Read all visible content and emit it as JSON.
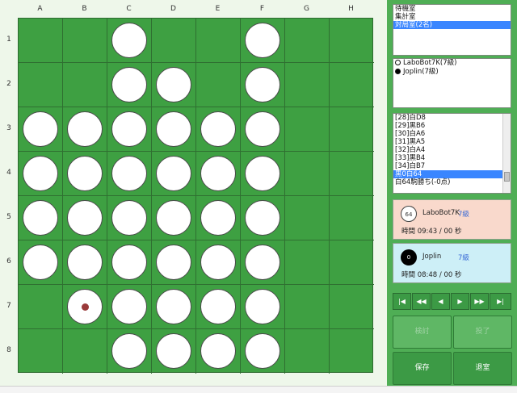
{
  "board": {
    "columns": [
      "A",
      "B",
      "C",
      "D",
      "E",
      "F",
      "G",
      "H"
    ],
    "rows": [
      "1",
      "2",
      "3",
      "4",
      "5",
      "6",
      "7",
      "8"
    ],
    "cells": [
      [
        0,
        0,
        1,
        0,
        0,
        1,
        0,
        0
      ],
      [
        0,
        0,
        1,
        1,
        0,
        1,
        0,
        0
      ],
      [
        1,
        1,
        1,
        1,
        1,
        1,
        0,
        0
      ],
      [
        1,
        1,
        1,
        1,
        1,
        1,
        0,
        0
      ],
      [
        1,
        1,
        1,
        1,
        1,
        1,
        0,
        0
      ],
      [
        1,
        1,
        1,
        1,
        1,
        1,
        0,
        0
      ],
      [
        0,
        1,
        1,
        1,
        1,
        1,
        0,
        0
      ],
      [
        0,
        0,
        1,
        1,
        1,
        1,
        0,
        0
      ]
    ],
    "last_move": {
      "row": 7,
      "col": "B"
    },
    "board_color": "#3ea042",
    "disc_color": "#ffffff"
  },
  "rooms": {
    "items": [
      "待機室",
      "集計室",
      "対局室(2名)"
    ],
    "selected": 2
  },
  "players_list": [
    {
      "color": "white",
      "label": "LaboBot7K(7級)"
    },
    {
      "color": "black",
      "label": "Joplin(7級)"
    }
  ],
  "moves": {
    "items": [
      "[28]白D8",
      "[29]黒B6",
      "[30]白A6",
      "[31]黒A5",
      "[32]白A4",
      "[33]黒B4",
      "[34]白B7",
      "黒0白64",
      "白64駒勝ち(-0点)"
    ],
    "selected": 7
  },
  "player_white": {
    "count": "64",
    "name": "LaboBot7K",
    "rank": "7級",
    "time": "時間 09:43 / 00 秒",
    "bg": "#f9d9cc"
  },
  "player_black": {
    "count": "0",
    "name": "Joplin",
    "rank": "7級",
    "time": "時間 08:48 / 00 秒",
    "bg": "#cdeff7"
  },
  "nav": {
    "first": "|◀",
    "prev_fast": "◀◀",
    "prev": "◀",
    "next": "▶",
    "next_fast": "▶▶",
    "last": "▶|"
  },
  "buttons": {
    "kento": "検討",
    "touryo": "投了",
    "save": "保存",
    "exit": "退室"
  }
}
